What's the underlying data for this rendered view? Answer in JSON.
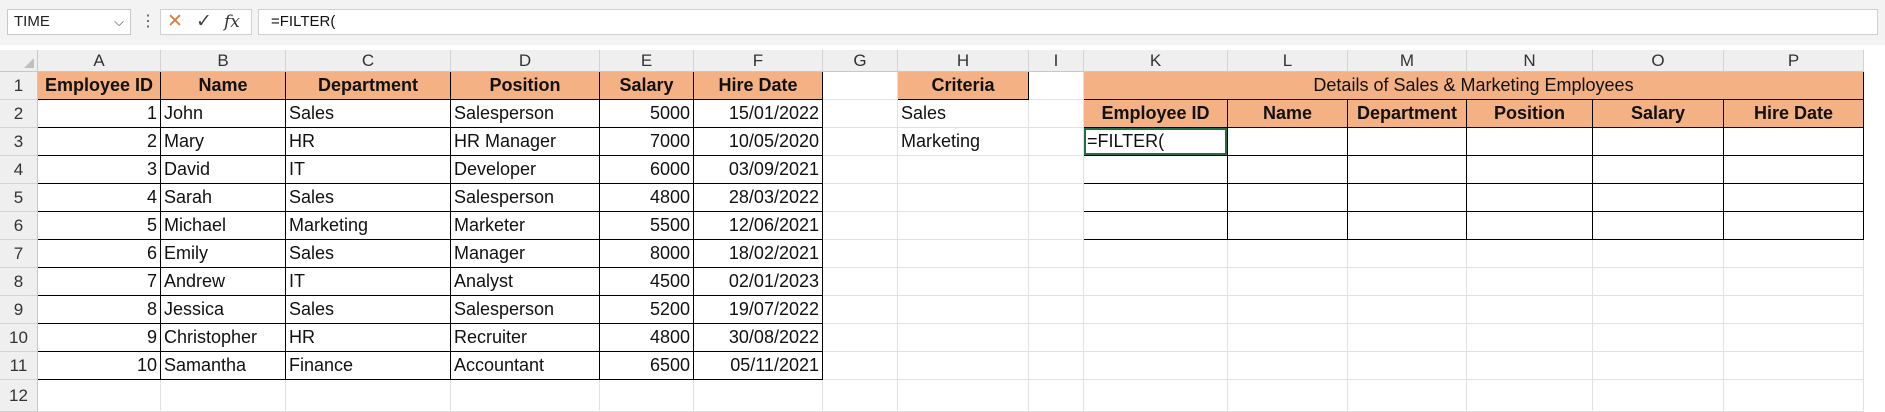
{
  "formula_bar": {
    "name_box": "TIME",
    "name_box_arrow": "⌵",
    "dots": "⋮",
    "cancel": "✕",
    "enter": "✓",
    "fx": "fx",
    "formula": "=FILTER("
  },
  "columns": [
    "A",
    "B",
    "C",
    "D",
    "E",
    "F",
    "G",
    "H",
    "I",
    "K",
    "L",
    "M",
    "N",
    "O",
    "P"
  ],
  "rows": [
    "1",
    "2",
    "3",
    "4",
    "5",
    "6",
    "7",
    "8",
    "9",
    "10",
    "11",
    "12"
  ],
  "table": {
    "headers": [
      "Employee ID",
      "Name",
      "Department",
      "Position",
      "Salary",
      "Hire Date"
    ],
    "rows": [
      [
        "1",
        "John",
        "Sales",
        "Salesperson",
        "5000",
        "15/01/2022"
      ],
      [
        "2",
        "Mary",
        "HR",
        "HR Manager",
        "7000",
        "10/05/2020"
      ],
      [
        "3",
        "David",
        "IT",
        "Developer",
        "6000",
        "03/09/2021"
      ],
      [
        "4",
        "Sarah",
        "Sales",
        "Salesperson",
        "4800",
        "28/03/2022"
      ],
      [
        "5",
        "Michael",
        "Marketing",
        "Marketer",
        "5500",
        "12/06/2021"
      ],
      [
        "6",
        "Emily",
        "Sales",
        "Manager",
        "8000",
        "18/02/2021"
      ],
      [
        "7",
        "Andrew",
        "IT",
        "Analyst",
        "4500",
        "02/01/2023"
      ],
      [
        "8",
        "Jessica",
        "Sales",
        "Salesperson",
        "5200",
        "19/07/2022"
      ],
      [
        "9",
        "Christopher",
        "HR",
        "Recruiter",
        "4800",
        "30/08/2022"
      ],
      [
        "10",
        "Samantha",
        "Finance",
        "Accountant",
        "6500",
        "05/11/2021"
      ]
    ]
  },
  "criteria": {
    "header": "Criteria",
    "values": [
      "Sales",
      "Marketing"
    ]
  },
  "result": {
    "title": "Details of Sales & Marketing Employees",
    "headers": [
      "Employee ID",
      "Name",
      "Department",
      "Position",
      "Salary",
      "Hire Date"
    ],
    "formula_cell": "=FILTER("
  },
  "colors": {
    "header_fill": "#f4b183",
    "active_border": "#1e7145",
    "cancel_icon": "#e07b39"
  }
}
